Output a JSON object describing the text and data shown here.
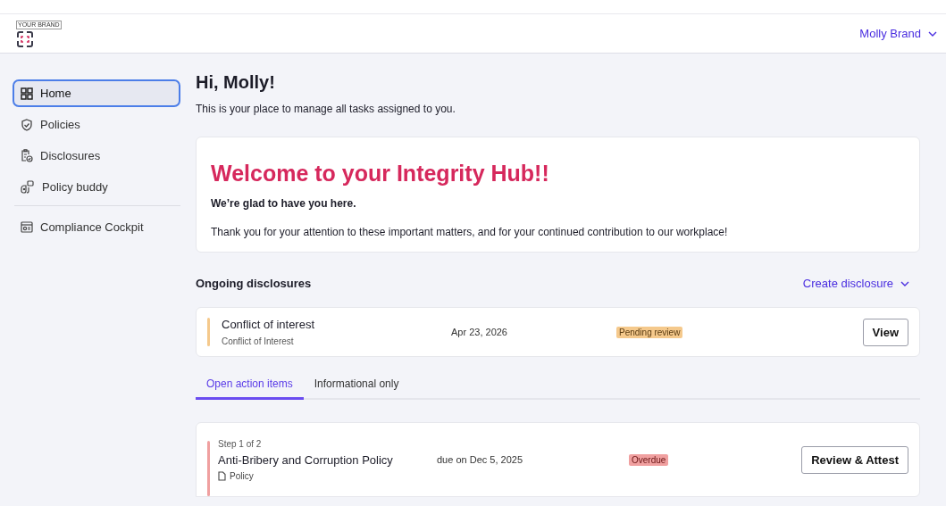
{
  "header": {
    "brand": "YOUR BRAND",
    "user": "Molly Brand"
  },
  "sidebar": {
    "items": [
      {
        "label": "Home",
        "selected": true
      },
      {
        "label": "Policies",
        "selected": false
      },
      {
        "label": "Disclosures",
        "selected": false
      },
      {
        "label": "Policy buddy",
        "selected": false
      },
      {
        "label": "Compliance Cockpit",
        "selected": false,
        "divider_before": true
      }
    ]
  },
  "greeting": {
    "title": "Hi, Molly!",
    "subtitle": "This is your place to manage all tasks assigned to you."
  },
  "welcome": {
    "title": "Welcome to your Integrity Hub!!",
    "lead": "We’re glad to have you here.",
    "body": "Thank you for your attention to these important matters, and for your continued contribution to our workplace!"
  },
  "disclosures": {
    "title": "Ongoing disclosures",
    "action": "Create disclosure",
    "items": [
      {
        "title": "Conflict of interest",
        "subtitle": "Conflict of Interest",
        "date": "Apr 23, 2026",
        "status": "Pending review",
        "color": "#f5c98c",
        "button": "View"
      }
    ]
  },
  "tabs": [
    {
      "label": "Open action items",
      "selected": true
    },
    {
      "label": "Informational only",
      "selected": false
    }
  ],
  "tasks": [
    {
      "step": "Step 1 of 2",
      "title": "Anti-Bribery and Corruption Policy",
      "type": "Policy",
      "due": "due on Dec 5, 2025",
      "status": "Overdue",
      "color": "#f0a0a0",
      "button": "Review & Attest"
    }
  ]
}
